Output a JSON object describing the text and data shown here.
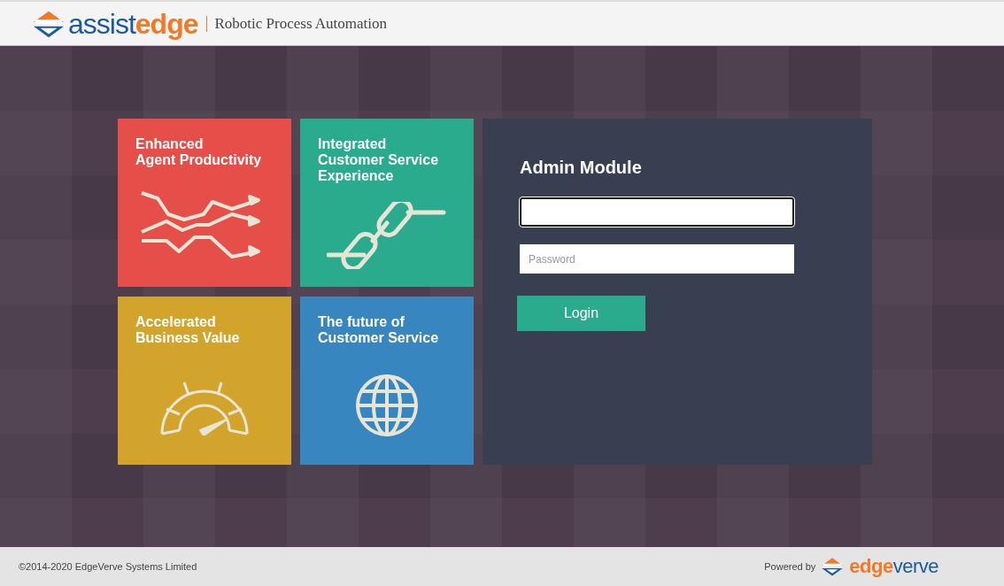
{
  "header": {
    "logo": {
      "part_1": "assist",
      "part_2": "edge"
    },
    "product": "Robotic Process Automation"
  },
  "tiles": [
    {
      "kind": "trend",
      "lines": [
        "Enhanced",
        "Agent Productivity"
      ],
      "color": "#e64f49"
    },
    {
      "kind": "link",
      "lines": [
        "Integrated",
        "Customer Service",
        "Experience"
      ],
      "color": "#2aab8e"
    },
    {
      "kind": "gauge",
      "lines": [
        "Accelerated",
        "Business Value"
      ],
      "color": "#d3a42b"
    },
    {
      "kind": "globe",
      "lines": [
        "The future of",
        "Customer Service"
      ],
      "color": "#3786c0"
    }
  ],
  "login": {
    "title": "Admin Module",
    "username": {
      "focused": true
    },
    "password": {
      "placeholder": "Password"
    },
    "button": "Login"
  },
  "footer": {
    "copyright": "©2014-2020 EdgeVerve Systems Limited",
    "powered_by": "Powered by",
    "logo": {
      "part_1": "edge",
      "part_2": "verve"
    }
  }
}
